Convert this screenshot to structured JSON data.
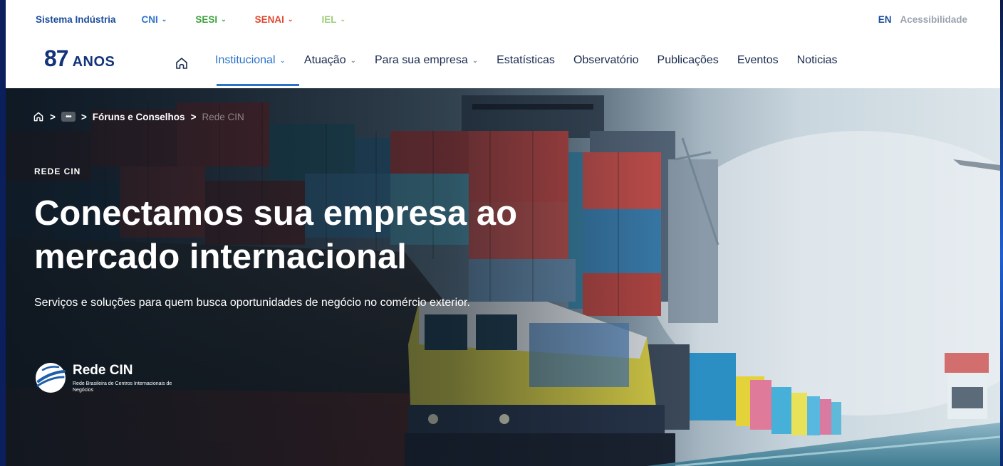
{
  "utility_bar": {
    "brand": "Sistema Indústria",
    "dropdowns": [
      {
        "label": "CNI",
        "color": "#2b73c8"
      },
      {
        "label": "SESI",
        "color": "#3ea33f"
      },
      {
        "label": "SENAI",
        "color": "#e2472f"
      },
      {
        "label": "IEL",
        "color": "#9ccf7a"
      }
    ],
    "language": "EN",
    "accessibility": "Acessibilidade"
  },
  "header": {
    "logo_number": "87",
    "logo_text": "ANOS",
    "home_icon": "home-icon",
    "nav": [
      {
        "label": "Institucional",
        "has_dropdown": true,
        "active": true
      },
      {
        "label": "Atuação",
        "has_dropdown": true
      },
      {
        "label": "Para sua empresa",
        "has_dropdown": true
      },
      {
        "label": "Estatísticas"
      },
      {
        "label": "Observatório"
      },
      {
        "label": "Publicações"
      },
      {
        "label": "Eventos"
      },
      {
        "label": "Noticias"
      }
    ]
  },
  "hero": {
    "breadcrumb": {
      "home_icon": "home-icon",
      "more": "•••",
      "parent": "Fóruns e Conselhos",
      "current": "Rede CIN"
    },
    "eyebrow": "REDE CIN",
    "headline_line1": "Conectamos sua empresa ao",
    "headline_line2": "mercado internacional",
    "subtitle": "Serviços e soluções para quem busca oportunidades de negócio no comércio exterior.",
    "partner_name": "Rede CIN",
    "partner_desc": "Rede Brasileira de Centros Internacionais de Negócios"
  },
  "colors": {
    "accent": "#2b73c8",
    "brand_navy": "#12327a"
  }
}
